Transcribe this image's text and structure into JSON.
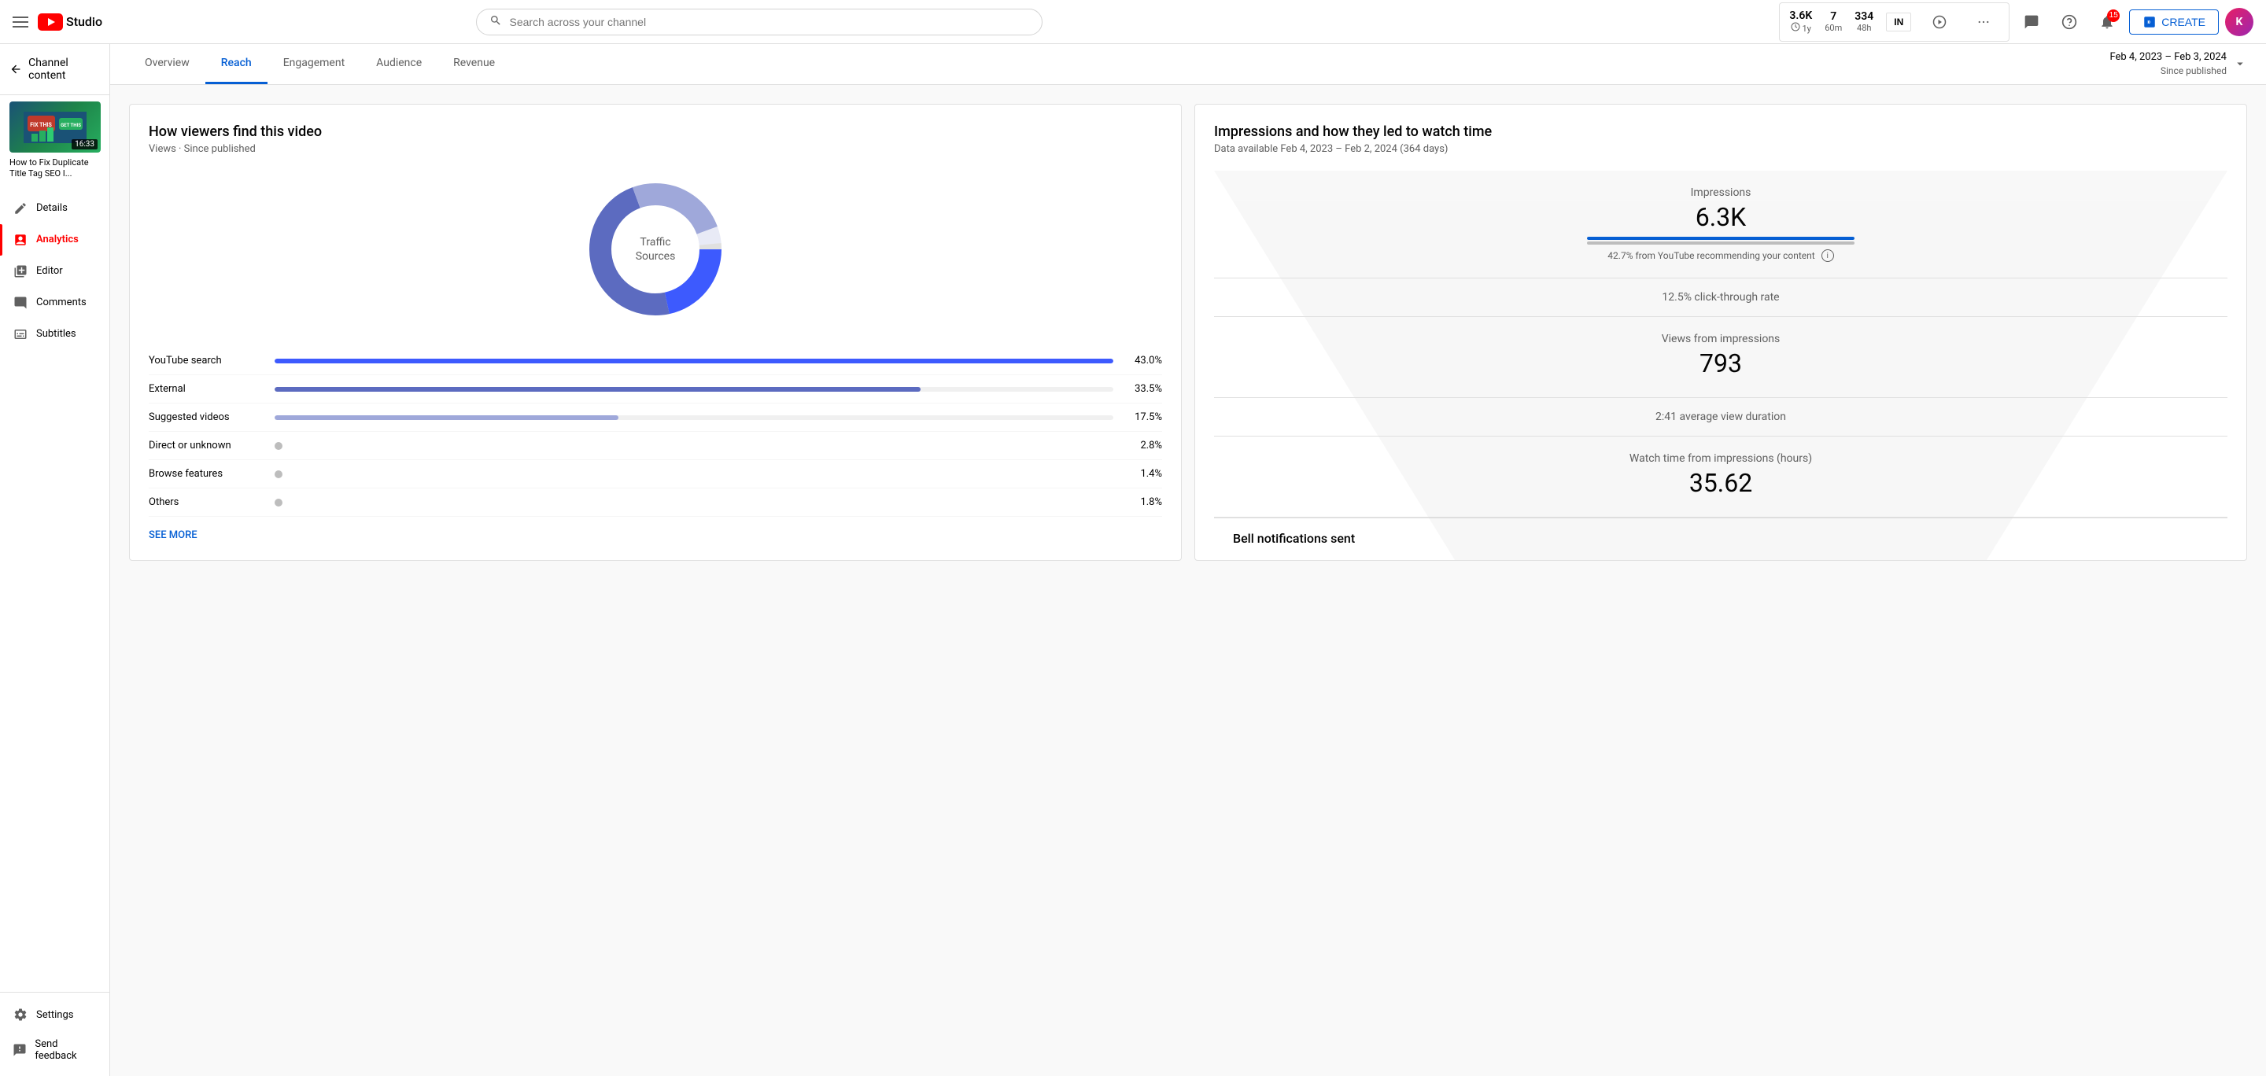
{
  "topNav": {
    "searchPlaceholder": "Search across your channel",
    "createLabel": "CREATE",
    "avatarInitial": "K",
    "stats": [
      {
        "value": "3.6K",
        "label": "1y"
      },
      {
        "value": "7",
        "label": "60m"
      },
      {
        "value": "334",
        "label": "48h"
      }
    ],
    "notificationCount": "15"
  },
  "sidebar": {
    "backLabel": "Channel content",
    "videoTitle": "How to Fix Duplicate Title Tag SEO I...",
    "videoDuration": "16:33",
    "items": [
      {
        "label": "Details",
        "icon": "pencil",
        "active": false
      },
      {
        "label": "Analytics",
        "icon": "analytics",
        "active": true
      },
      {
        "label": "Editor",
        "icon": "editor",
        "active": false
      },
      {
        "label": "Comments",
        "icon": "comments",
        "active": false
      },
      {
        "label": "Subtitles",
        "icon": "subtitles",
        "active": false
      }
    ],
    "bottomItems": [
      {
        "label": "Settings",
        "icon": "settings",
        "active": false
      },
      {
        "label": "Send feedback",
        "icon": "feedback",
        "active": false
      }
    ]
  },
  "tabs": [
    {
      "label": "Overview",
      "active": false
    },
    {
      "label": "Reach",
      "active": true
    },
    {
      "label": "Engagement",
      "active": false
    },
    {
      "label": "Audience",
      "active": false
    },
    {
      "label": "Revenue",
      "active": false
    }
  ],
  "dateRange": {
    "range": "Feb 4, 2023 – Feb 3, 2024",
    "label": "Since published"
  },
  "trafficSources": {
    "title": "How viewers find this video",
    "subtitle": "Views · Since published",
    "centerLabel1": "Traffic",
    "centerLabel2": "Sources",
    "sources": [
      {
        "name": "YouTube search",
        "pct": 43.0,
        "pctLabel": "43.0%",
        "barType": "dark-blue",
        "hasDot": false
      },
      {
        "name": "External",
        "pct": 33.5,
        "pctLabel": "33.5%",
        "barType": "medium-blue",
        "hasDot": false
      },
      {
        "name": "Suggested videos",
        "pct": 17.5,
        "pctLabel": "17.5%",
        "barType": "light-purple",
        "hasDot": false
      },
      {
        "name": "Direct or unknown",
        "pct": 2.8,
        "pctLabel": "2.8%",
        "barType": "dot-gray",
        "hasDot": true
      },
      {
        "name": "Browse features",
        "pct": 1.4,
        "pctLabel": "1.4%",
        "barType": "dot-gray",
        "hasDot": true
      },
      {
        "name": "Others",
        "pct": 1.8,
        "pctLabel": "1.8%",
        "barType": "dot-gray",
        "hasDot": true
      }
    ],
    "seeMore": "SEE MORE"
  },
  "impressions": {
    "title": "Impressions and how they led to watch time",
    "subtitle": "Data available Feb 4, 2023 – Feb 2, 2024 (364 days)",
    "sections": [
      {
        "metric": "Impressions",
        "value": "6.3K",
        "sub": "42.7% from YouTube recommending your content",
        "barPct": 100,
        "hasInfo": true
      },
      {
        "metric": "12.5% click-through rate",
        "value": "",
        "sub": "",
        "barPct": 0,
        "isRate": true
      },
      {
        "metric": "Views from impressions",
        "value": "793",
        "sub": "",
        "barPct": 0
      },
      {
        "metric": "2:41 average view duration",
        "value": "",
        "sub": "",
        "barPct": 0,
        "isRate": true
      },
      {
        "metric": "Watch time from impressions (hours)",
        "value": "35.62",
        "sub": "",
        "barPct": 0
      }
    ]
  },
  "bellSection": {
    "label": "Bell notifications sent"
  }
}
